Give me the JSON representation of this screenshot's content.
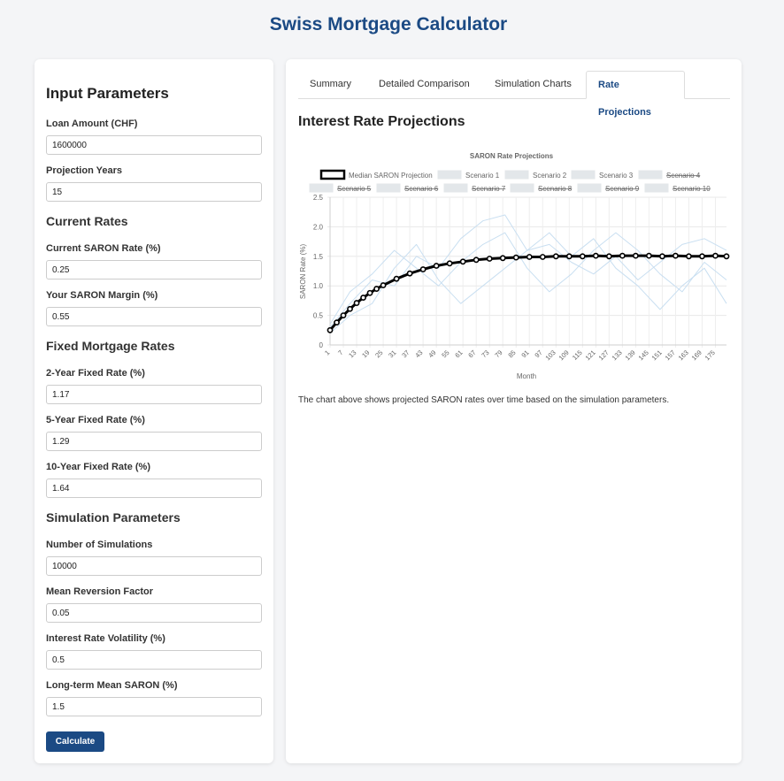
{
  "app": {
    "title": "Swiss Mortgage Calculator"
  },
  "inputs": {
    "title": "Input Parameters",
    "loan_amount": {
      "label": "Loan Amount (CHF)",
      "value": "1600000"
    },
    "projection_years": {
      "label": "Projection Years",
      "value": "15"
    },
    "current_rates_title": "Current Rates",
    "current_saron": {
      "label": "Current SARON Rate (%)",
      "value": "0.25"
    },
    "saron_margin": {
      "label": "Your SARON Margin (%)",
      "value": "0.55"
    },
    "fixed_rates_title": "Fixed Mortgage Rates",
    "fixed_2y": {
      "label": "2-Year Fixed Rate (%)",
      "value": "1.17"
    },
    "fixed_5y": {
      "label": "5-Year Fixed Rate (%)",
      "value": "1.29"
    },
    "fixed_10y": {
      "label": "10-Year Fixed Rate (%)",
      "value": "1.64"
    },
    "simulation_title": "Simulation Parameters",
    "num_simulations": {
      "label": "Number of Simulations",
      "value": "10000"
    },
    "mean_reversion": {
      "label": "Mean Reversion Factor",
      "value": "0.05"
    },
    "volatility": {
      "label": "Interest Rate Volatility (%)",
      "value": "0.5"
    },
    "long_term_mean": {
      "label": "Long-term Mean SARON (%)",
      "value": "1.5"
    },
    "calculate_label": "Calculate"
  },
  "tabs": [
    {
      "label": "Summary",
      "active": false
    },
    {
      "label": "Detailed Comparison",
      "active": false
    },
    {
      "label": "Simulation Charts",
      "active": false
    },
    {
      "label": "Rate Projections",
      "active": true
    }
  ],
  "content": {
    "title": "Interest Rate Projections",
    "description": "The chart above shows projected SARON rates over time based on the simulation parameters."
  },
  "colors": {
    "brand": "#1b4a84",
    "median_line": "#000000",
    "scenario_line": "#c9dff1"
  },
  "chart_data": {
    "type": "line",
    "title": "SARON Rate Projections",
    "xlabel": "Month",
    "ylabel": "SARON Rate (%)",
    "ylim": [
      0,
      2.5
    ],
    "y_ticks": [
      "0",
      "0.5",
      "1.0",
      "1.5",
      "2.0",
      "2.5"
    ],
    "x_range": [
      1,
      180
    ],
    "x_ticks": [
      "1",
      "7",
      "13",
      "19",
      "25",
      "31",
      "37",
      "43",
      "49",
      "55",
      "61",
      "67",
      "73",
      "79",
      "85",
      "91",
      "97",
      "103",
      "109",
      "115",
      "121",
      "127",
      "133",
      "139",
      "145",
      "151",
      "157",
      "163",
      "169",
      "175"
    ],
    "grid": true,
    "legend_position": "top",
    "legend": [
      {
        "name": "Median SARON Projection",
        "hidden": false
      },
      {
        "name": "Scenario 1",
        "hidden": false
      },
      {
        "name": "Scenario 2",
        "hidden": false
      },
      {
        "name": "Scenario 3",
        "hidden": false
      },
      {
        "name": "Scenario 4",
        "hidden": true
      },
      {
        "name": "Scenario 5",
        "hidden": true
      },
      {
        "name": "Scenario 6",
        "hidden": true
      },
      {
        "name": "Scenario 7",
        "hidden": true
      },
      {
        "name": "Scenario 8",
        "hidden": true
      },
      {
        "name": "Scenario 9",
        "hidden": true
      },
      {
        "name": "Scenario 10",
        "hidden": true
      }
    ],
    "median": {
      "name": "Median SARON Projection",
      "x": [
        1,
        4,
        7,
        10,
        13,
        16,
        19,
        22,
        25,
        31,
        37,
        43,
        49,
        55,
        61,
        67,
        73,
        79,
        85,
        91,
        97,
        103,
        109,
        115,
        121,
        127,
        133,
        139,
        145,
        151,
        157,
        163,
        169,
        175,
        180
      ],
      "y": [
        0.25,
        0.38,
        0.5,
        0.61,
        0.71,
        0.8,
        0.88,
        0.95,
        1.01,
        1.12,
        1.21,
        1.28,
        1.34,
        1.38,
        1.41,
        1.44,
        1.46,
        1.47,
        1.48,
        1.49,
        1.49,
        1.5,
        1.5,
        1.5,
        1.51,
        1.5,
        1.51,
        1.51,
        1.51,
        1.5,
        1.51,
        1.5,
        1.5,
        1.51,
        1.5
      ]
    },
    "series": [
      {
        "name": "Scenario 1",
        "x": [
          1,
          10,
          20,
          30,
          40,
          50,
          60,
          70,
          80,
          90,
          100,
          110,
          120,
          130,
          140,
          150,
          160,
          170,
          180
        ],
        "y": [
          0.3,
          0.7,
          1.1,
          1.0,
          1.5,
          1.3,
          1.8,
          2.1,
          2.2,
          1.6,
          1.7,
          1.4,
          1.2,
          1.5,
          1.1,
          1.4,
          1.7,
          1.8,
          1.6
        ]
      },
      {
        "name": "Scenario 2",
        "x": [
          1,
          10,
          20,
          30,
          40,
          50,
          60,
          70,
          80,
          90,
          100,
          110,
          120,
          130,
          140,
          150,
          160,
          170,
          180
        ],
        "y": [
          0.2,
          0.5,
          0.7,
          1.3,
          1.7,
          1.1,
          0.7,
          1.0,
          1.3,
          1.6,
          1.9,
          1.5,
          1.8,
          1.3,
          1.0,
          0.6,
          1.0,
          1.3,
          0.7
        ]
      },
      {
        "name": "Scenario 3",
        "x": [
          1,
          10,
          20,
          30,
          40,
          50,
          60,
          70,
          80,
          90,
          100,
          110,
          120,
          130,
          140,
          150,
          160,
          170,
          180
        ],
        "y": [
          0.35,
          0.9,
          1.2,
          1.6,
          1.3,
          1.0,
          1.4,
          1.7,
          1.9,
          1.3,
          0.9,
          1.2,
          1.6,
          1.9,
          1.6,
          1.2,
          0.9,
          1.4,
          1.1
        ]
      }
    ]
  }
}
